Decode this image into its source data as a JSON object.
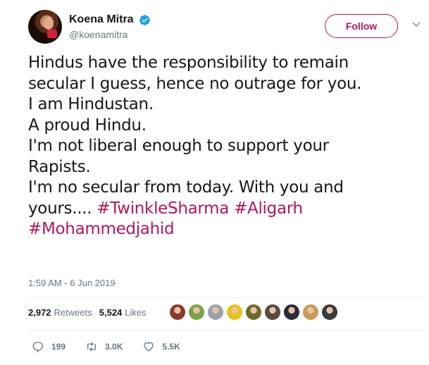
{
  "header": {
    "display_name": "Koena Mitra",
    "handle": "@koenamitra",
    "follow_label": "Follow",
    "verified": true
  },
  "tweet": {
    "lines": [
      "Hindus have the responsibility to remain",
      "secular I guess, hence no outrage for you.",
      "I am Hindustan.",
      "A proud Hindu.",
      "I'm not liberal enough to support your",
      "Rapists.",
      "I'm no secular from today. With you and"
    ],
    "line8_prefix": "yours.... ",
    "hashtags": [
      "#TwinkleSharma",
      "#Aligarh",
      "#Mohammedjahid"
    ]
  },
  "timestamp": "1:59 AM - 6 Jun 2019",
  "stats": {
    "retweets_count": "2,972",
    "retweets_label": "Retweets",
    "likes_count": "5,524",
    "likes_label": "Likes"
  },
  "liker_avatar_colors": [
    "#8a3b2a",
    "#7aa34a",
    "#9aa3ad",
    "#e8c21a",
    "#6b6b2a",
    "#5a4a44",
    "#2a2a3a",
    "#c89a5a",
    "#3a3a3a"
  ],
  "actions": {
    "reply_count": "199",
    "retweet_count": "3.0K",
    "like_count": "5.5K"
  },
  "colors": {
    "accent": "#b0155f",
    "verified": "#1da1f2",
    "muted": "#657786"
  }
}
